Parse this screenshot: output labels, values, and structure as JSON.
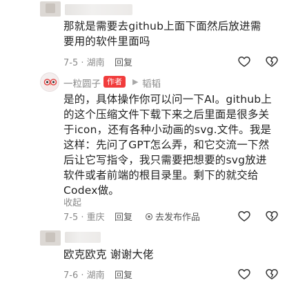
{
  "comments": [
    {
      "text": "那就是需要去github上面下面然后放进需要用的软件里面吗",
      "date": "7-5",
      "location": "湖南",
      "reply_label": "回复"
    },
    {
      "author": "一粒圆子",
      "author_badge": "作者",
      "reply_to": "韬韬",
      "text": "是的，具体操作你可以问一下AI。github上的这个压缩文件下载下来之后里面是很多关于icon，还有各种小动画的svg.文件。我是这样：先问了GPT怎么弄，和它交流一下然后让它写指令，我只需要把想要的svg放进软件或者前端的根目录里。剩下的就交给Codex做。",
      "fold_label": "收起",
      "date": "7-5",
      "location": "重庆",
      "reply_label": "回复",
      "publish_label": "去发布作品"
    },
    {
      "text": "欧克欧克  谢谢大佬",
      "date": "7-6",
      "location": "湖南",
      "reply_label": "回复"
    }
  ],
  "icons": {
    "like": "heart-outline-icon",
    "dislike": "broken-heart-outline-icon",
    "publish": "camera-icon",
    "reply_arrow": "triangle-right-icon"
  },
  "colors": {
    "badge": "#f13c3c",
    "meta_text": "#8a8a8a"
  }
}
